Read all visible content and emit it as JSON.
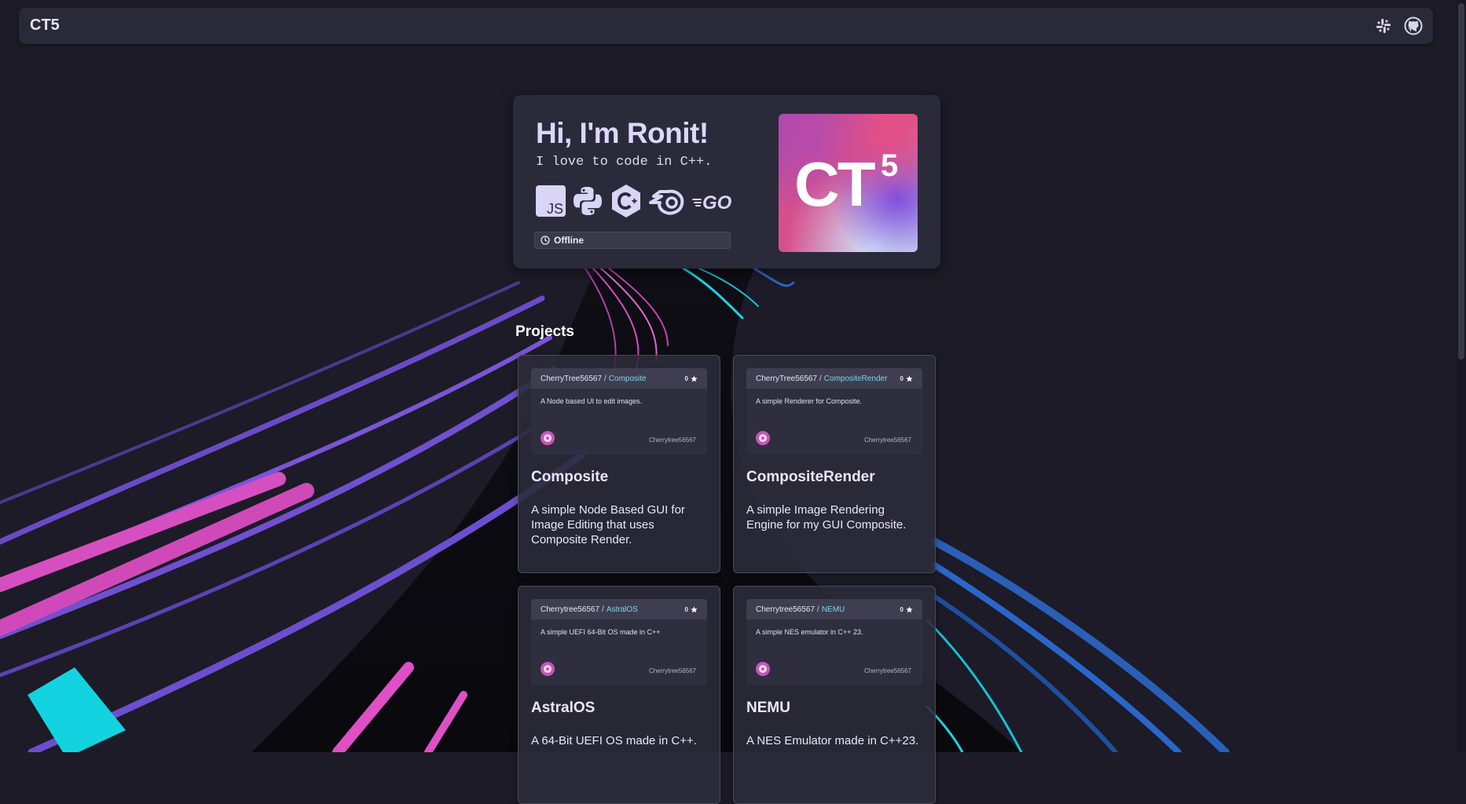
{
  "header": {
    "brand": "CT5",
    "icons": [
      "slack-icon",
      "github-icon"
    ]
  },
  "hero": {
    "title": "Hi, I'm Ronit!",
    "subtitle": "I love to code in C++.",
    "languages": [
      {
        "name": "JavaScript",
        "icon": "javascript-icon",
        "label": "JS"
      },
      {
        "name": "Python",
        "icon": "python-icon"
      },
      {
        "name": "C++",
        "icon": "cplusplus-icon"
      },
      {
        "name": "Blender",
        "icon": "blender-icon"
      },
      {
        "name": "Go",
        "icon": "go-icon",
        "label": "GO"
      }
    ],
    "status": "Offline",
    "logo": {
      "text": "CT",
      "superscript": "5"
    }
  },
  "projects": {
    "heading": "Projects",
    "items": [
      {
        "owner": "CherryTree56567",
        "repo": "Composite",
        "stars": "0",
        "repo_description": "A Node based UI to edit images.",
        "avatar_owner": "Cherrytree56567",
        "title": "Composite",
        "description": "A simple Node Based GUI for Image Editing that uses Composite Render."
      },
      {
        "owner": "CherryTree56567",
        "repo": "CompositeRender",
        "stars": "0",
        "repo_description": "A simple Renderer for Composite.",
        "avatar_owner": "Cherrytree56567",
        "title": "CompositeRender",
        "description": "A simple Image Rendering Engine for my GUI Composite."
      },
      {
        "owner": "Cherrytree56567",
        "repo": "AstralOS",
        "stars": "0",
        "repo_description": "A simple UEFI 64-Bit OS made in C++",
        "avatar_owner": "Cherrytree56567",
        "title": "AstralOS",
        "description": "A 64-Bit UEFI OS made in C++."
      },
      {
        "owner": "Cherrytree56567",
        "repo": "NEMU",
        "stars": "0",
        "repo_description": "A simple NES emulator in C++ 23.",
        "avatar_owner": "Cherrytree56567",
        "title": "NEMU",
        "description": "A NES Emulator made in C++23."
      }
    ]
  },
  "colors": {
    "background": "#1c1b27",
    "card": "#2b2a3a",
    "accent_link": "#7fd3ea",
    "neon_pink": "#e04bc0",
    "neon_violet": "#6b4bd6",
    "neon_cyan": "#19d6e6",
    "neon_blue": "#2a66c9"
  }
}
